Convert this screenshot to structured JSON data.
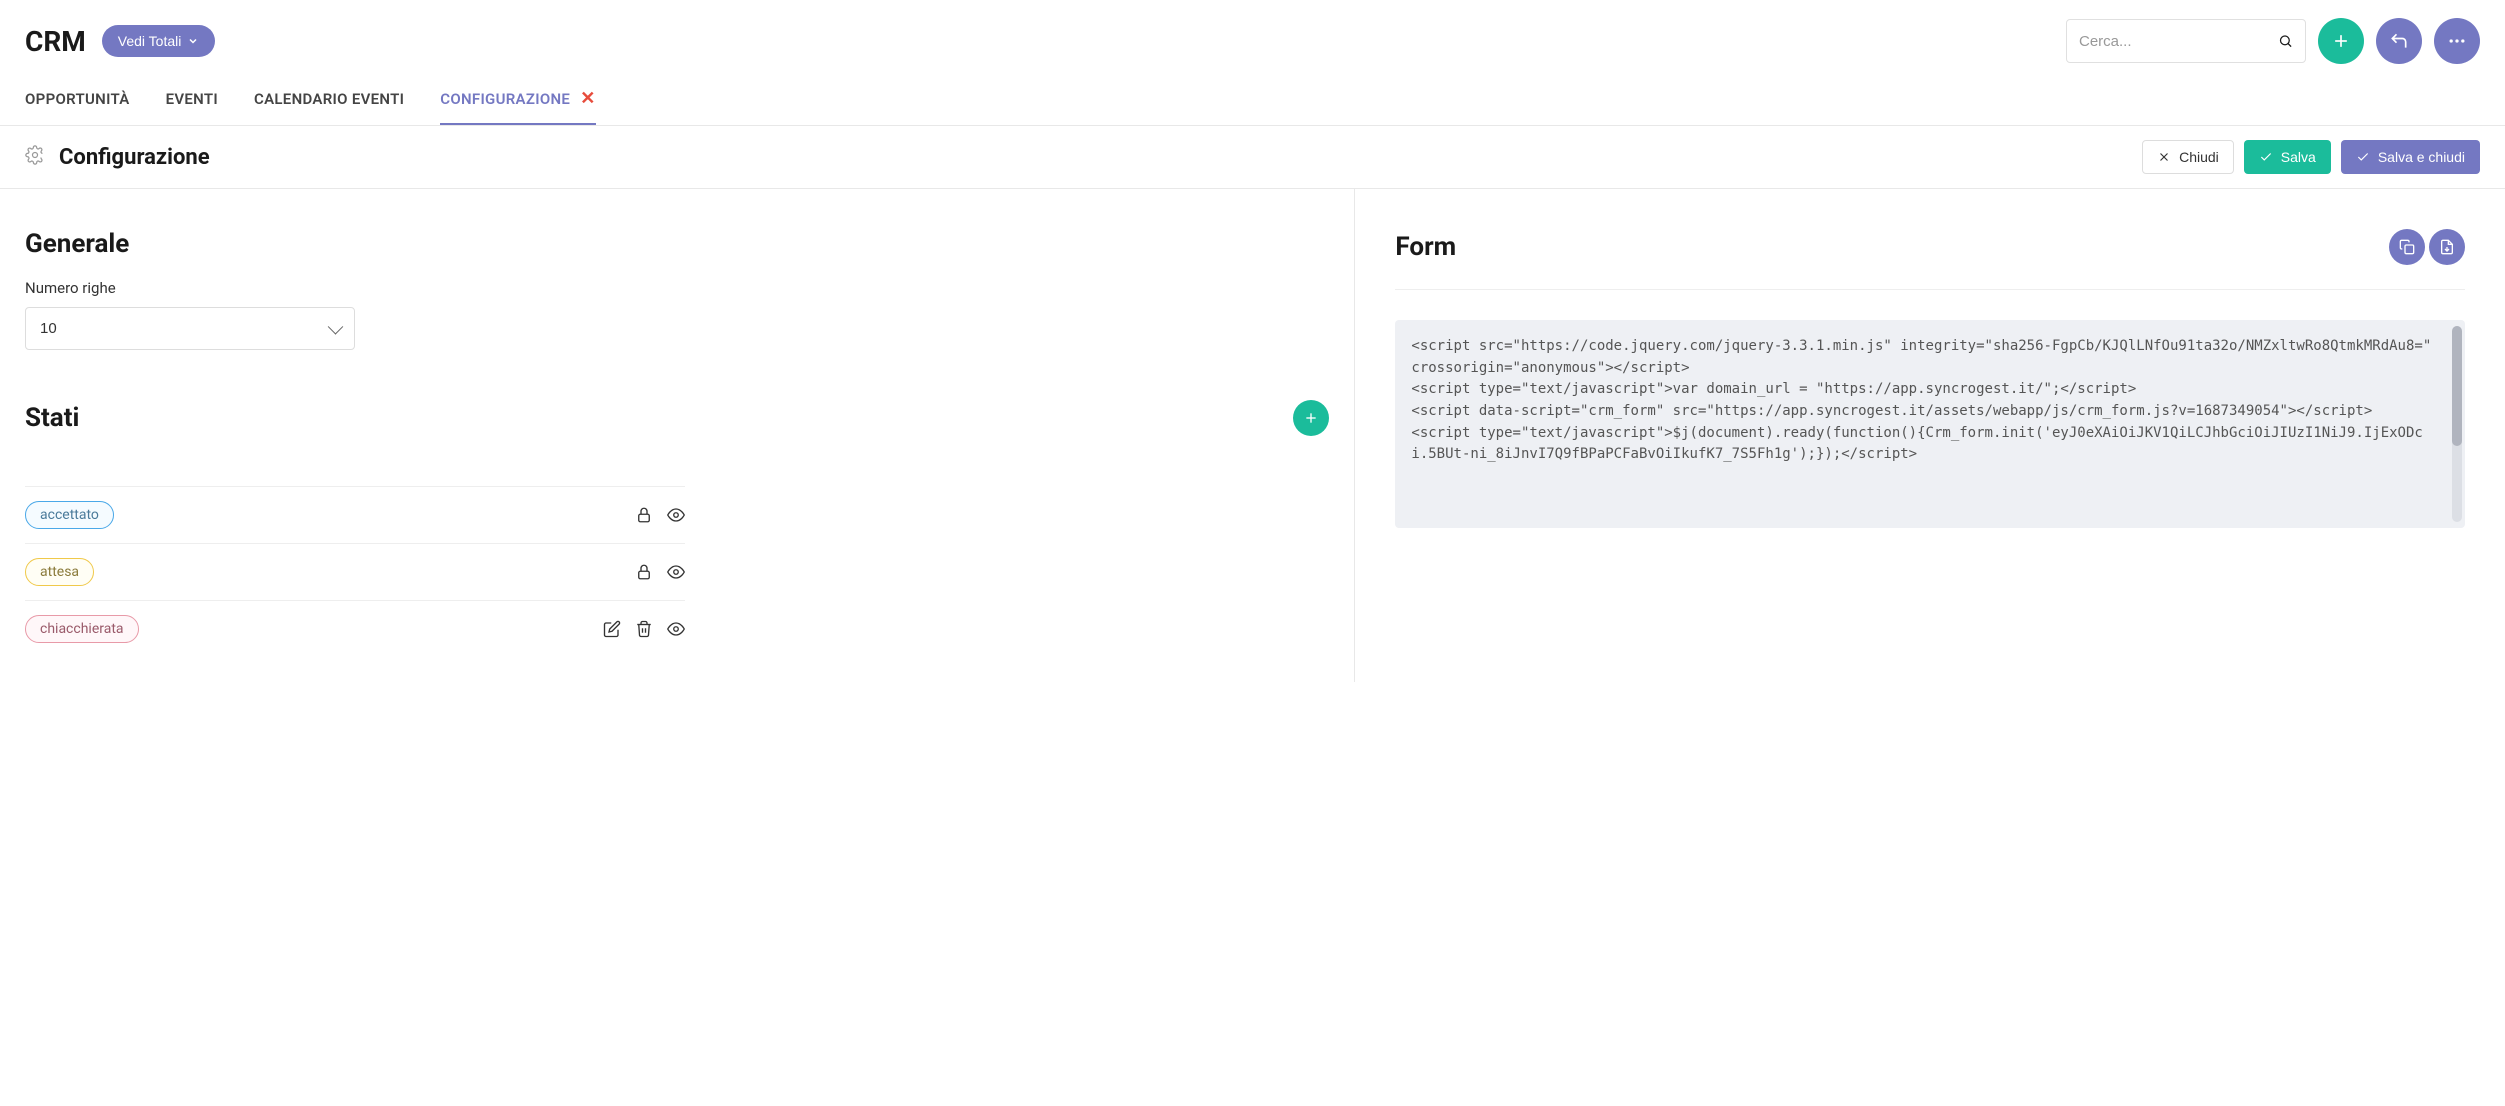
{
  "app": {
    "title": "CRM",
    "vedi_totali": "Vedi Totali"
  },
  "search": {
    "placeholder": "Cerca..."
  },
  "tabs": {
    "opportunita": "OPPORTUNITÀ",
    "eventi": "EVENTI",
    "calendario": "CALENDARIO EVENTI",
    "configurazione": "CONFIGURAZIONE"
  },
  "subheader": {
    "title": "Configurazione",
    "chiudi": "Chiudi",
    "salva": "Salva",
    "salva_chiudi": "Salva e chiudi"
  },
  "generale": {
    "heading": "Generale",
    "numero_righe_label": "Numero righe",
    "numero_righe_value": "10"
  },
  "stati": {
    "heading": "Stati",
    "items": [
      {
        "label": "accettato",
        "color": "blue",
        "locked": true
      },
      {
        "label": "attesa",
        "color": "yellow",
        "locked": true
      },
      {
        "label": "chiacchierata",
        "color": "pink",
        "locked": false
      }
    ]
  },
  "form": {
    "heading": "Form",
    "code": "<script src=\"https://code.jquery.com/jquery-3.3.1.min.js\" integrity=\"sha256-FgpCb/KJQlLNfOu91ta32o/NMZxltwRo8QtmkMRdAu8=\" crossorigin=\"anonymous\"></script>\n<script type=\"text/javascript\">var domain_url = \"https://app.syncrogest.it/\";</script>\n<script data-script=\"crm_form\" src=\"https://app.syncrogest.it/assets/webapp/js/crm_form.js?v=1687349054\"></script>\n<script type=\"text/javascript\">$j(document).ready(function(){Crm_form.init('eyJ0eXAiOiJKV1QiLCJhbGciOiJIUzI1NiJ9.IjExODci.5BUt-ni_8iJnvI7Q9fBPaPCFaBvOiIkufK7_7S5Fh1g');});</script>"
  }
}
